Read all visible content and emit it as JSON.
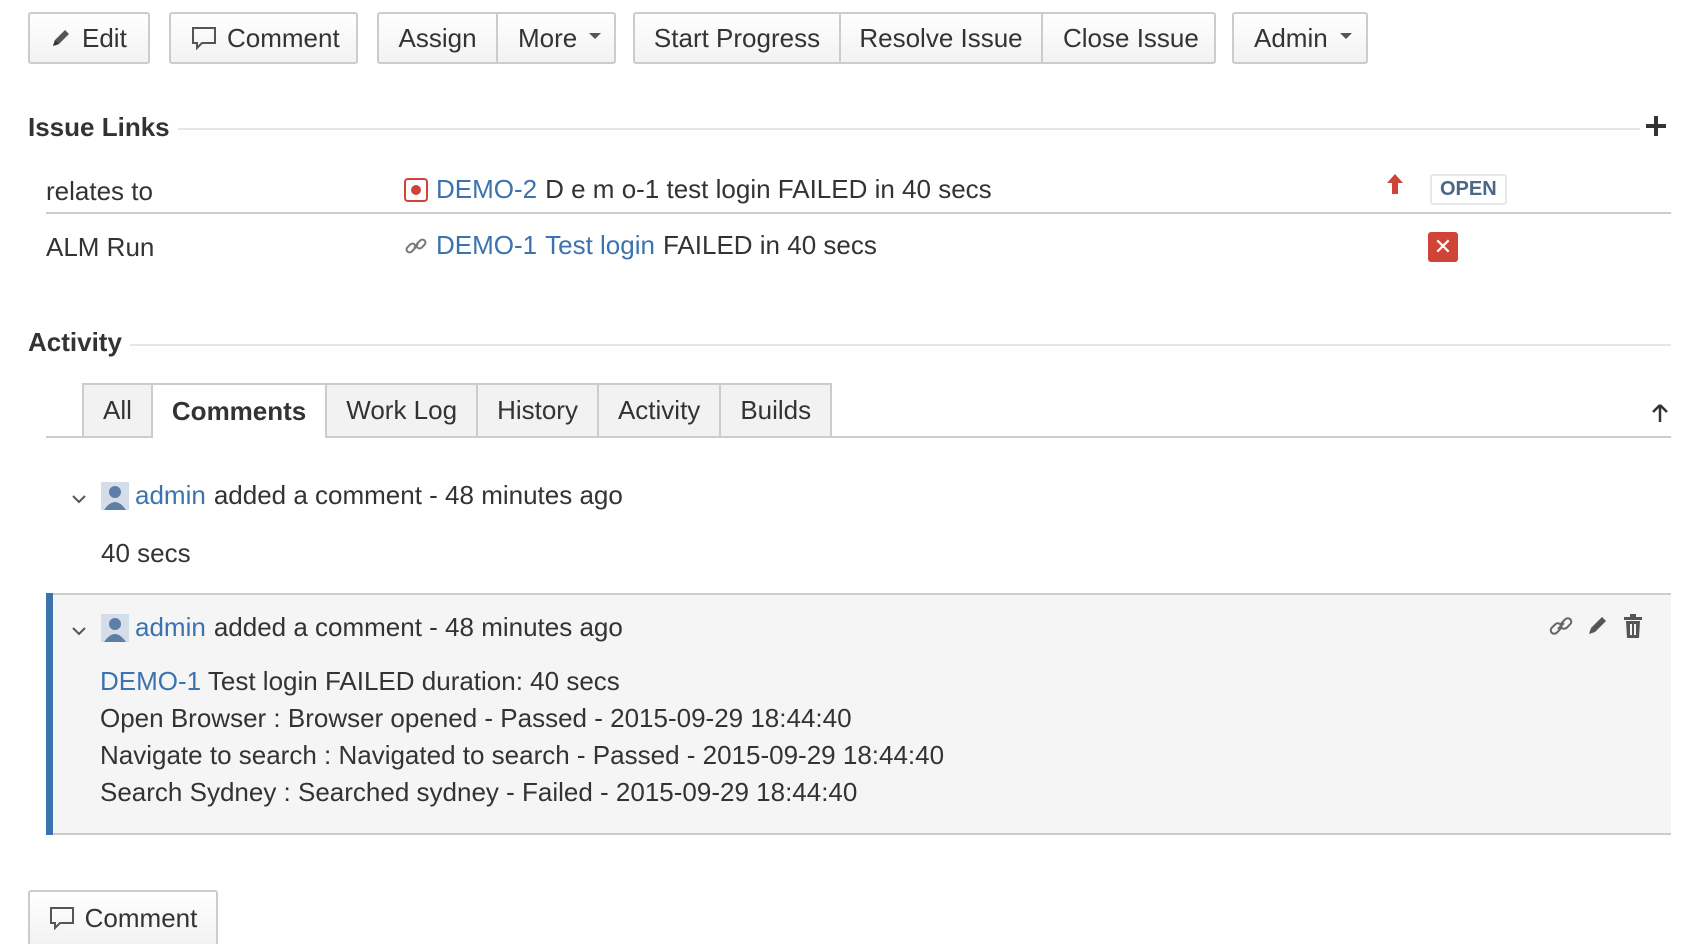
{
  "toolbar": {
    "edit": "Edit",
    "comment": "Comment",
    "assign": "Assign",
    "more": "More",
    "start_progress": "Start Progress",
    "resolve_issue": "Resolve Issue",
    "close_issue": "Close Issue",
    "admin": "Admin"
  },
  "issue_links": {
    "title": "Issue Links",
    "rows": [
      {
        "type": "relates to",
        "key": "DEMO-2",
        "summary": "D e m o-1 test login FAILED in 40 secs",
        "priority_icon": "arrow-up-icon",
        "status": "OPEN"
      },
      {
        "type": "ALM Run",
        "key": "DEMO-1",
        "summary_link": "Test login",
        "summary": "FAILED in 40 secs",
        "status_icon": "close-icon"
      }
    ]
  },
  "activity": {
    "title": "Activity",
    "tabs": [
      "All",
      "Comments",
      "Work Log",
      "History",
      "Activity",
      "Builds"
    ],
    "active_tab": "Comments",
    "comments": [
      {
        "user": "admin",
        "action": "added a comment - 48 minutes ago",
        "body": "40 secs"
      },
      {
        "user": "admin",
        "action": "added a comment - 48 minutes ago",
        "body_key": "DEMO-1",
        "body_first": "Test login FAILED duration: 40 secs",
        "body_lines": [
          "Open Browser : Browser opened - Passed - 2015-09-29 18:44:40",
          "Navigate to search : Navigated to search - Passed - 2015-09-29 18:44:40",
          "Search Sydney : Searched sydney - Failed - 2015-09-29 18:44:40"
        ]
      }
    ]
  },
  "bottom": {
    "comment_button": "Comment"
  },
  "colors": {
    "link": "#3b73af",
    "priority": "#d04437",
    "failed": "#d04437",
    "status_open": "#4a6785"
  }
}
